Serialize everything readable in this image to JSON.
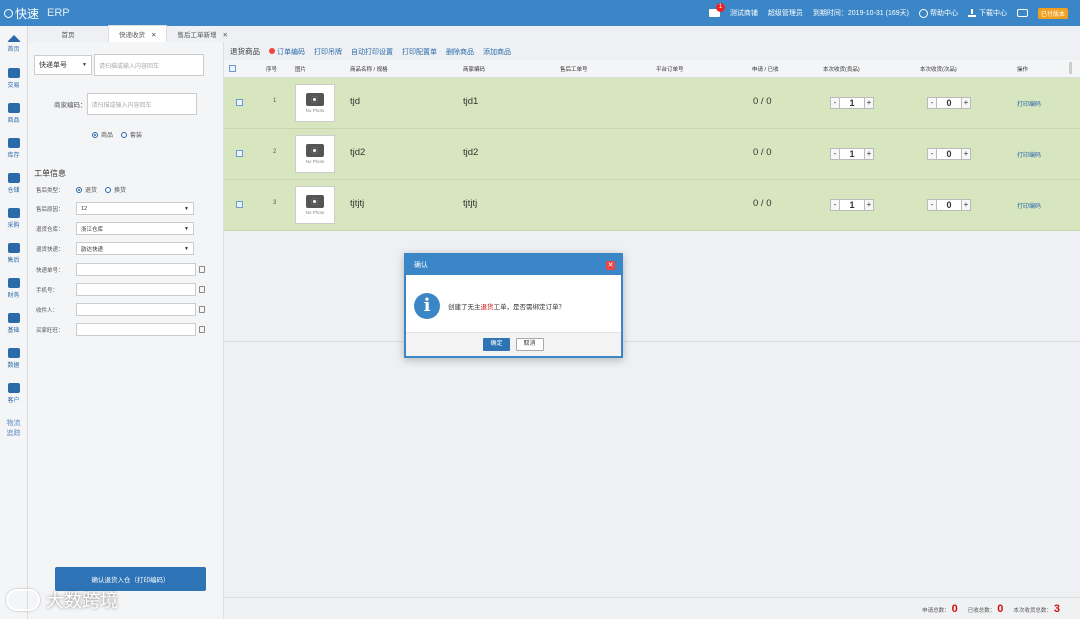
{
  "app": {
    "brand": "快速",
    "title": "ERP"
  },
  "topbar": {
    "mail_count": "1",
    "user": "测试商铺",
    "role": "超级管理员",
    "expiry": "到期时间：2019-10-31 (169天)",
    "help": "帮助中心",
    "download": "下载中心",
    "badge": "已付版本"
  },
  "nav": [
    {
      "label": "首页",
      "icon": "home-icon"
    },
    {
      "label": "交易",
      "icon": "trade-icon"
    },
    {
      "label": "商品",
      "icon": "goods-icon"
    },
    {
      "label": "库存",
      "icon": "stock-icon"
    },
    {
      "label": "仓储",
      "icon": "warehouse-icon"
    },
    {
      "label": "采购",
      "icon": "cart-icon"
    },
    {
      "label": "售后",
      "icon": "aftersale-icon"
    },
    {
      "label": "财务",
      "icon": "finance-icon"
    },
    {
      "label": "基础",
      "icon": "settings-icon"
    },
    {
      "label": "数据",
      "icon": "data-icon"
    },
    {
      "label": "客户",
      "icon": "user-icon"
    },
    {
      "label": "物流追踪",
      "icon": ""
    }
  ],
  "tabs": [
    {
      "label": "首页",
      "closable": false
    },
    {
      "label": "快递收货",
      "closable": true
    },
    {
      "label": "售后工单新增",
      "closable": true
    }
  ],
  "form": {
    "scan_type": "快递单号",
    "scan_placeholder": "请扫描或输入内容回车",
    "code_label": "商家编码：",
    "code_placeholder": "请扫描或输入内容回车",
    "radio_goods": "商品",
    "radio_suite": "套装",
    "section_title": "工单信息",
    "type_label": "售后类型：",
    "type_return": "退货",
    "type_exchange": "换货",
    "reason_label": "售后原因：",
    "reason_value": "12",
    "warehouse_label": "退货仓库：",
    "warehouse_value": "浙江仓库",
    "express_label": "退货快递：",
    "express_value": "韵达快递",
    "tracking_label": "快递单号：",
    "phone_label": "手机号：",
    "receiver_label": "收件人：",
    "buyer_label": "买家旺旺：",
    "confirm_button": "确认退货入仓（打印编码）"
  },
  "toolbar": {
    "heading": "退货商品",
    "actions": [
      "订单编码",
      "打印吊牌",
      "自动打印设置",
      "打印配置单",
      "删除商品",
      "添加商品"
    ]
  },
  "table": {
    "headers": {
      "index": "序号",
      "image": "图片",
      "name": "商品名称 / 规格",
      "code": "商家编码",
      "ticket": "售后工单号",
      "platform": "平台订单号",
      "apply": "申请 / 已收",
      "recv_good": "本次收货(良品)",
      "recv_defect": "本次收货(次品)",
      "op": "操作"
    },
    "no_photo": "No Photo",
    "rows": [
      {
        "index": "1",
        "name": "tjd",
        "code": "tjd1",
        "apply": "0 / 0",
        "good": "1",
        "defect": "0",
        "op": "打印编码"
      },
      {
        "index": "2",
        "name": "tjd2",
        "code": "tjd2",
        "apply": "0 / 0",
        "good": "1",
        "defect": "0",
        "op": "打印编码"
      },
      {
        "index": "3",
        "name": "tjtjtj",
        "code": "tjtjtj",
        "apply": "0 / 0",
        "good": "1",
        "defect": "0",
        "op": "打印编码"
      }
    ]
  },
  "footer": {
    "apply_total_label": "申请总数：",
    "apply_total": "0",
    "received_label": "已收总数：",
    "received": "0",
    "this_label": "本次收货总数：",
    "this_total": "3"
  },
  "watermark": "大数跨境",
  "modal": {
    "title": "确认",
    "msg_pre": "创建了无主",
    "msg_em": "退货",
    "msg_post": "工单，是否需绑定订单？",
    "ok": "确定",
    "cancel": "取消"
  },
  "colors": {
    "primary": "#3b86c6",
    "row_bg": "#d8e6c0",
    "danger": "#d01010"
  }
}
